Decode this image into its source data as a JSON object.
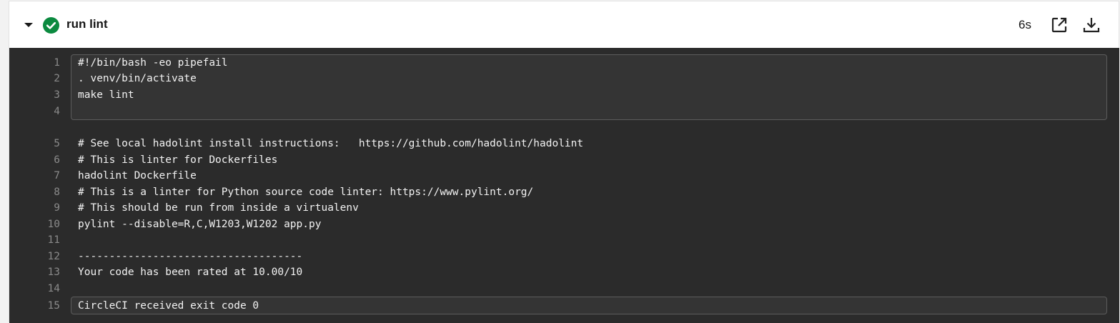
{
  "step": {
    "title": "run lint",
    "duration": "6s",
    "status": "success",
    "status_color": "#0b8a3f",
    "icons": {
      "collapse": "caret-down-icon",
      "status": "check-circle-icon",
      "open_new": "external-link-icon",
      "download": "download-icon"
    }
  },
  "log": {
    "lines": [
      {
        "n": "1",
        "text": "#!/bin/bash -eo pipefail"
      },
      {
        "n": "2",
        "text": ". venv/bin/activate"
      },
      {
        "n": "3",
        "text": "make lint"
      },
      {
        "n": "4",
        "text": ""
      },
      {
        "n": "5",
        "text": "# See local hadolint install instructions:   https://github.com/hadolint/hadolint"
      },
      {
        "n": "6",
        "text": "# This is linter for Dockerfiles"
      },
      {
        "n": "7",
        "text": "hadolint Dockerfile"
      },
      {
        "n": "8",
        "text": "# This is a linter for Python source code linter: https://www.pylint.org/"
      },
      {
        "n": "9",
        "text": "# This should be run from inside a virtualenv"
      },
      {
        "n": "10",
        "text": "pylint --disable=R,C,W1203,W1202 app.py"
      },
      {
        "n": "11",
        "text": ""
      },
      {
        "n": "12",
        "text": "------------------------------------"
      },
      {
        "n": "13",
        "text": "Your code has been rated at 10.00/10"
      },
      {
        "n": "14",
        "text": ""
      },
      {
        "n": "15",
        "text": "CircleCI received exit code 0"
      }
    ]
  }
}
